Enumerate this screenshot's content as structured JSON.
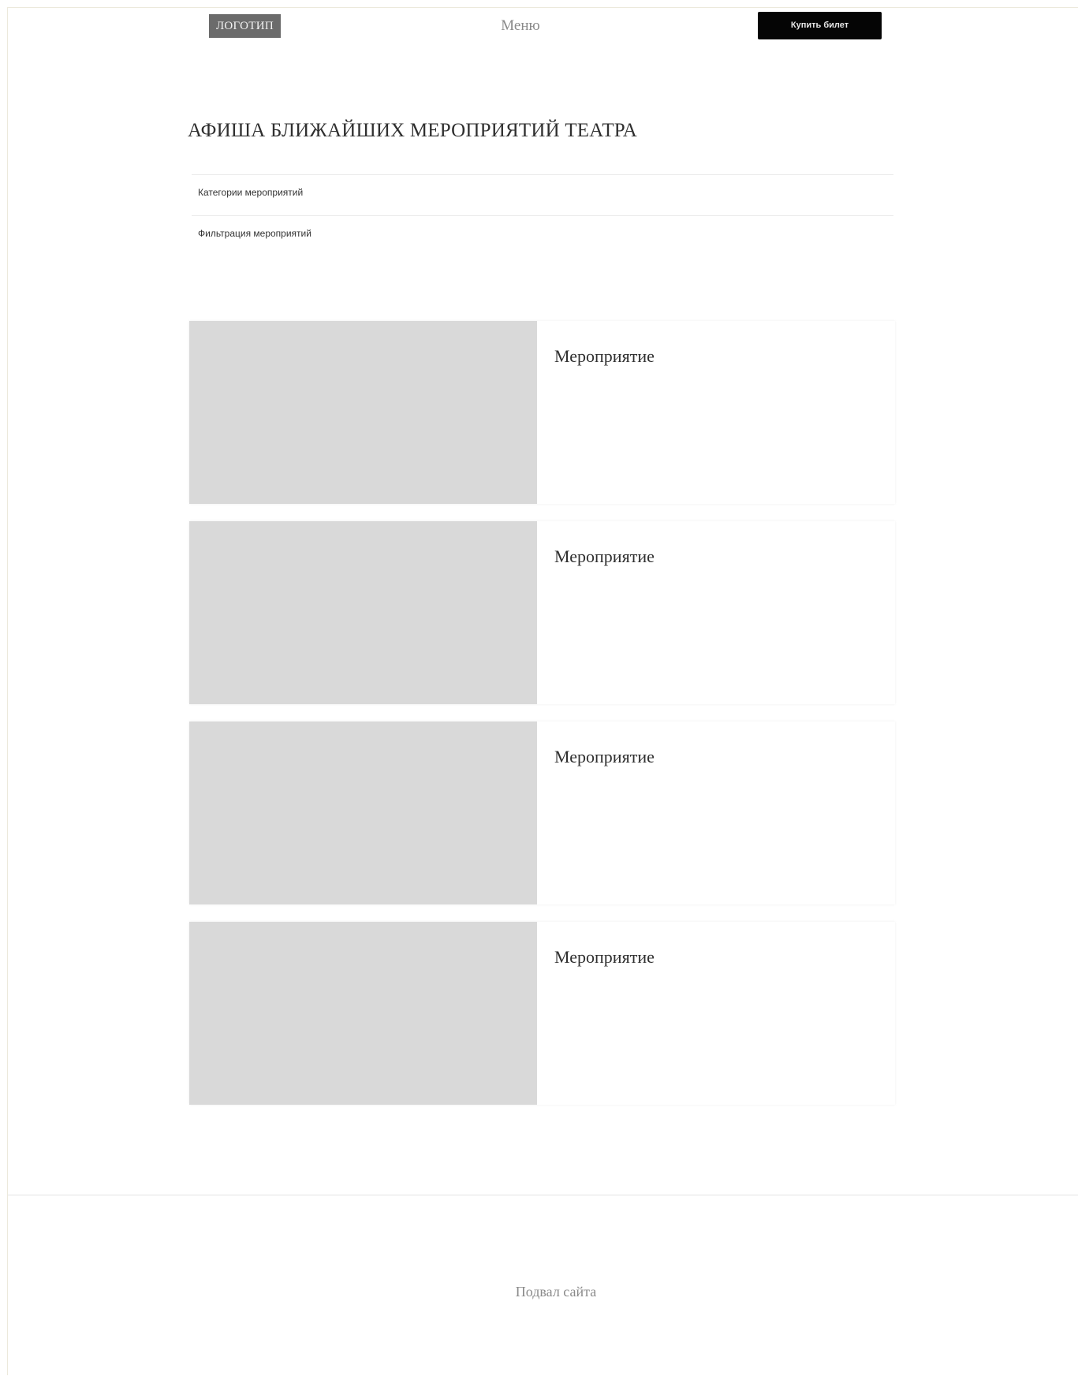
{
  "header": {
    "logo_label": "ЛОГОТИП",
    "menu_label": "Меню",
    "buy_button_label": "Купить билет"
  },
  "main": {
    "title": "АФИША БЛИЖАЙШИХ МЕРОПРИЯТИЙ ТЕАТРА",
    "filters": [
      {
        "label": "Категории мероприятий"
      },
      {
        "label": "Фильтрация мероприятий"
      }
    ],
    "events": [
      {
        "title": "Мероприятие"
      },
      {
        "title": "Мероприятие"
      },
      {
        "title": "Мероприятие"
      },
      {
        "title": "Мероприятие"
      }
    ]
  },
  "footer": {
    "text": "Подвал сайта"
  },
  "colors": {
    "logo_bg": "#6b6b6b",
    "button_bg": "#050505",
    "image_placeholder": "#d9d9d9"
  }
}
